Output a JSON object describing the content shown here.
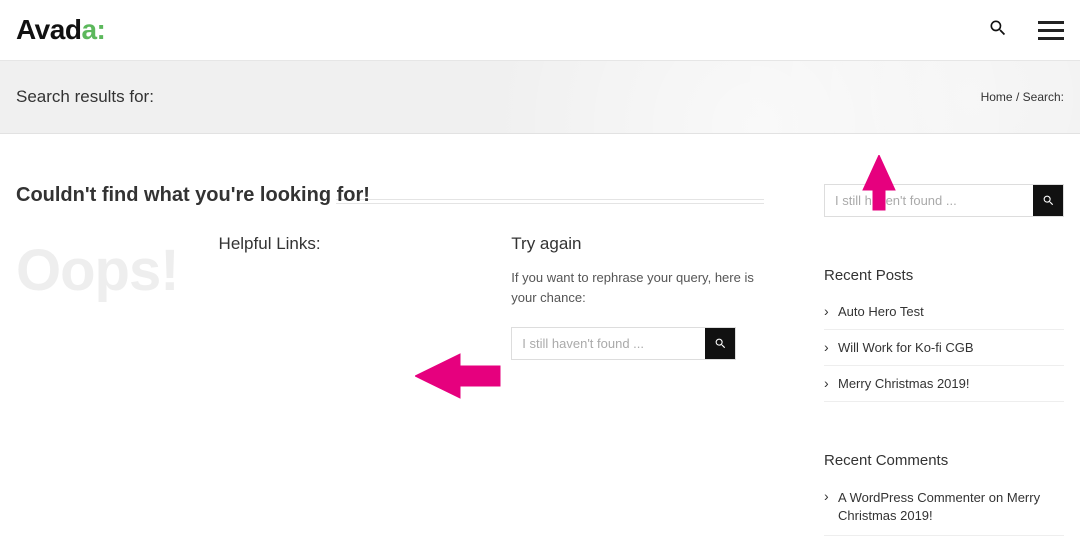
{
  "logo": {
    "part1": "Avad",
    "part2": "a",
    "colon": ":"
  },
  "titlebar": {
    "title": "Search results for:"
  },
  "breadcrumbs": {
    "home": "Home",
    "sep": "/",
    "current": "Search:"
  },
  "notfound": {
    "heading": "Couldn't find what you're looking for!",
    "oops": "Oops!",
    "helpful_title": "Helpful Links:",
    "try_title": "Try again",
    "try_desc": "If you want to rephrase your query, here is your chance:"
  },
  "search": {
    "placeholder": "I still haven't found ..."
  },
  "sidebar": {
    "recent_posts_title": "Recent Posts",
    "recent_posts": [
      "Auto Hero Test",
      "Will Work for Ko-fi CGB",
      "Merry Christmas 2019!"
    ],
    "recent_comments_title": "Recent Comments",
    "recent_comments": [
      {
        "author": "A WordPress Commenter",
        "on": "on",
        "post": "Merry Christmas 2019!"
      }
    ]
  }
}
